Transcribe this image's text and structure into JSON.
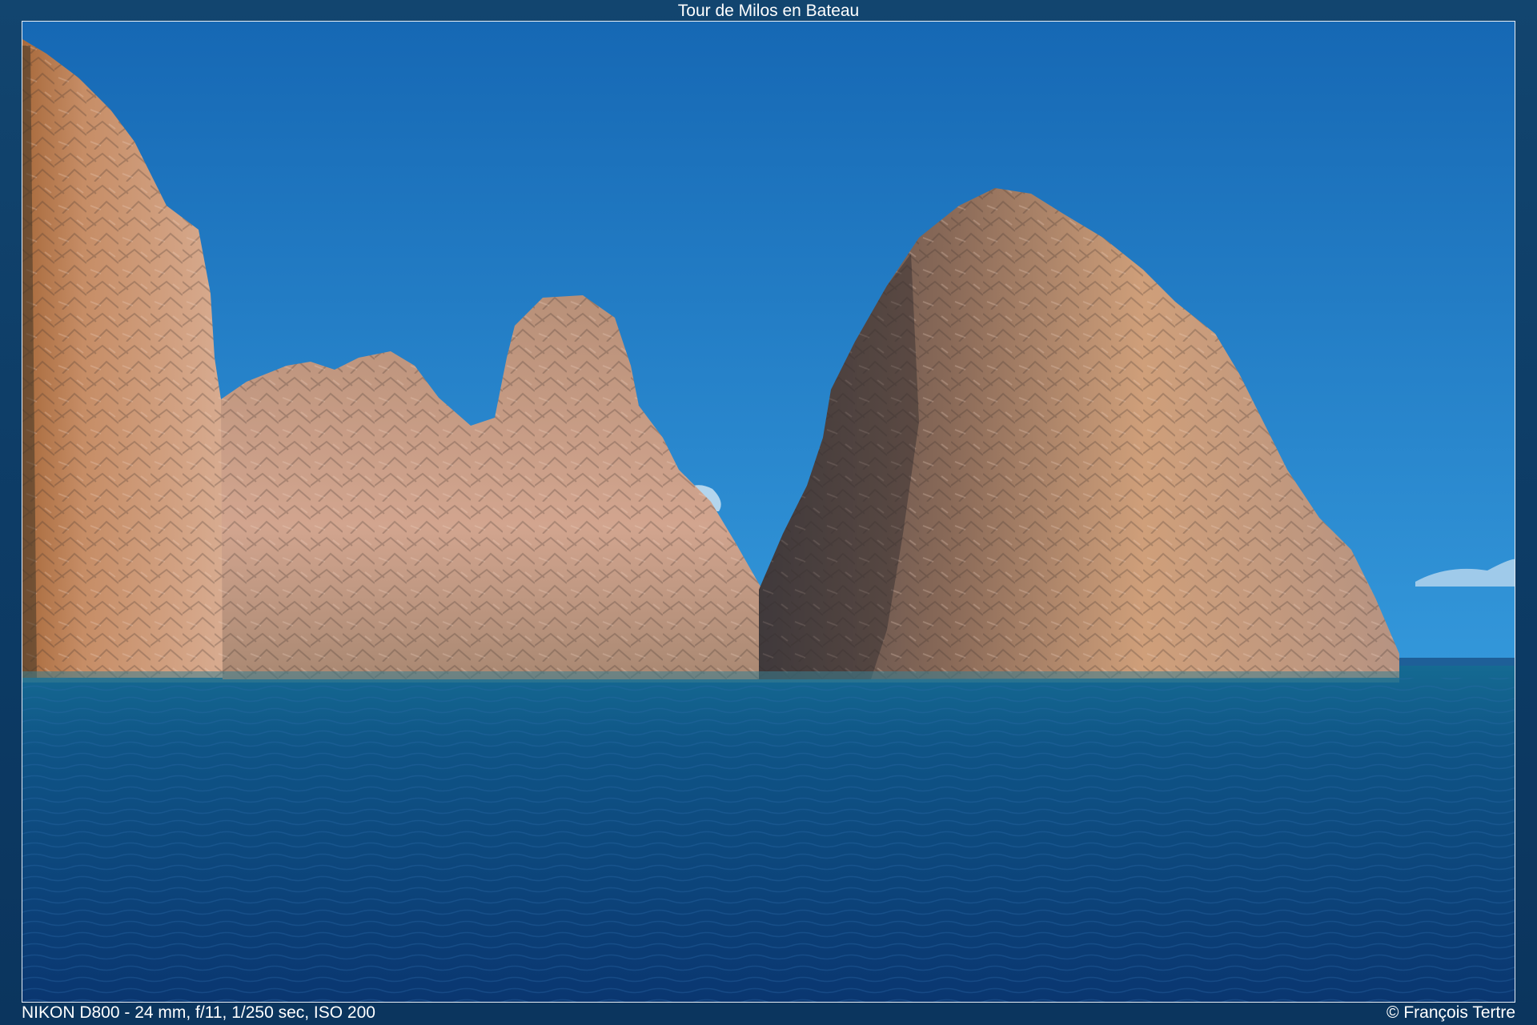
{
  "header": {
    "title": "Tour de Milos en Bateau"
  },
  "photo": {
    "subject": "sea-stack-rocks",
    "colors": {
      "sky_top": "#1a74be",
      "sky_bottom": "#2d92d6",
      "sea_top": "#13689a",
      "sea_bottom": "#0b3b78",
      "rock_light": "#d2a27f",
      "rock_dark": "#5a4a44"
    }
  },
  "footer": {
    "exif": "NIKON D800 - 24 mm, f/11, 1/250 sec, ISO 200",
    "copyright": "© François Tertre"
  }
}
